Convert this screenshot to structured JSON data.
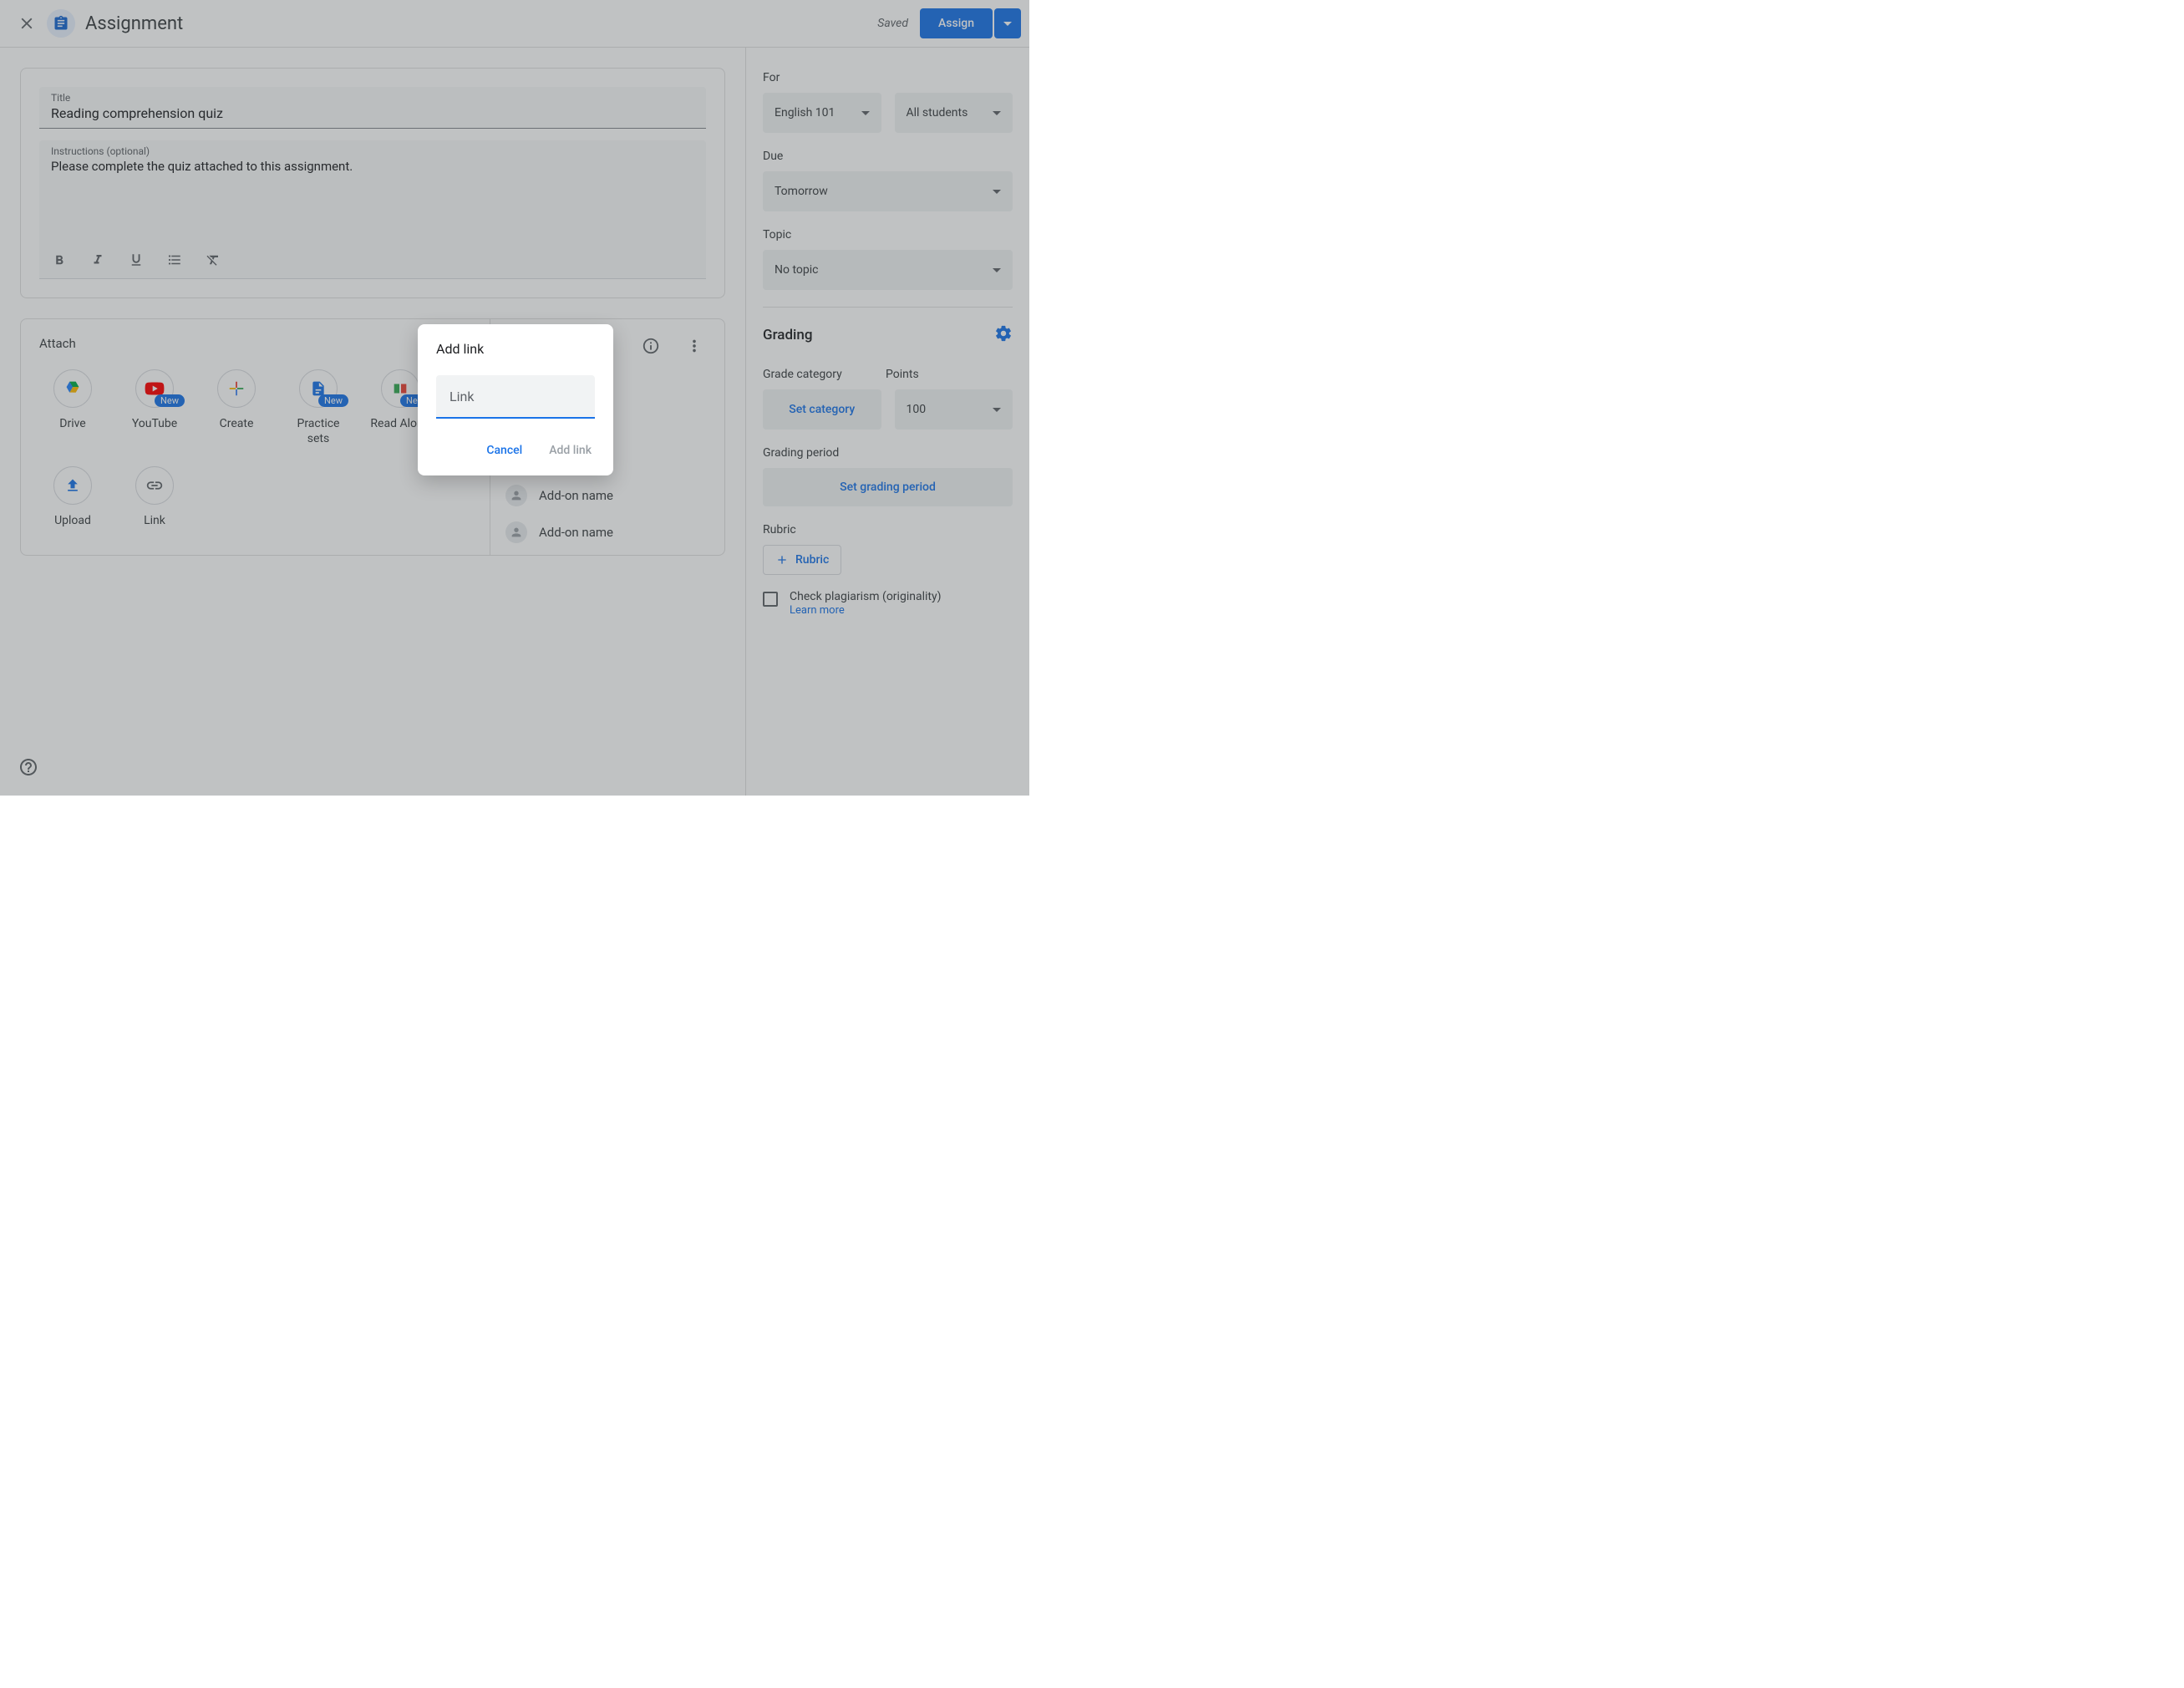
{
  "header": {
    "page_title": "Assignment",
    "saved_label": "Saved",
    "assign_label": "Assign"
  },
  "main": {
    "title_label": "Title",
    "title_value": "Reading comprehension quiz",
    "instructions_label": "Instructions (optional)",
    "instructions_value": "Please complete the quiz attached to this assignment.",
    "attach_label": "Attach",
    "attach_items": [
      {
        "label": "Drive",
        "icon": "drive",
        "new": false
      },
      {
        "label": "YouTube",
        "icon": "youtube",
        "new": true
      },
      {
        "label": "Create",
        "icon": "create",
        "new": false
      },
      {
        "label": "Practice sets",
        "icon": "practice",
        "new": true
      },
      {
        "label": "Read Along",
        "icon": "readalong",
        "new": true
      },
      {
        "label": "Upload",
        "icon": "upload",
        "new": false
      },
      {
        "label": "Link",
        "icon": "link",
        "new": false
      }
    ],
    "new_badge": "New",
    "addons": [
      {
        "label": "Add-on name"
      },
      {
        "label": "Add-on name"
      }
    ]
  },
  "sidebar": {
    "for_label": "For",
    "class_value": "English 101",
    "students_value": "All students",
    "due_label": "Due",
    "due_value": "Tomorrow",
    "topic_label": "Topic",
    "topic_value": "No topic",
    "grading_heading": "Grading",
    "grade_category_label": "Grade category",
    "grade_category_value": "Set category",
    "points_label": "Points",
    "points_value": "100",
    "grading_period_label": "Grading period",
    "grading_period_btn": "Set grading period",
    "rubric_label": "Rubric",
    "rubric_btn": "Rubric",
    "plagiarism_label": "Check plagiarism (originality)",
    "learn_more": "Learn more"
  },
  "dialog": {
    "title": "Add link",
    "placeholder": "Link",
    "cancel": "Cancel",
    "add": "Add link"
  }
}
